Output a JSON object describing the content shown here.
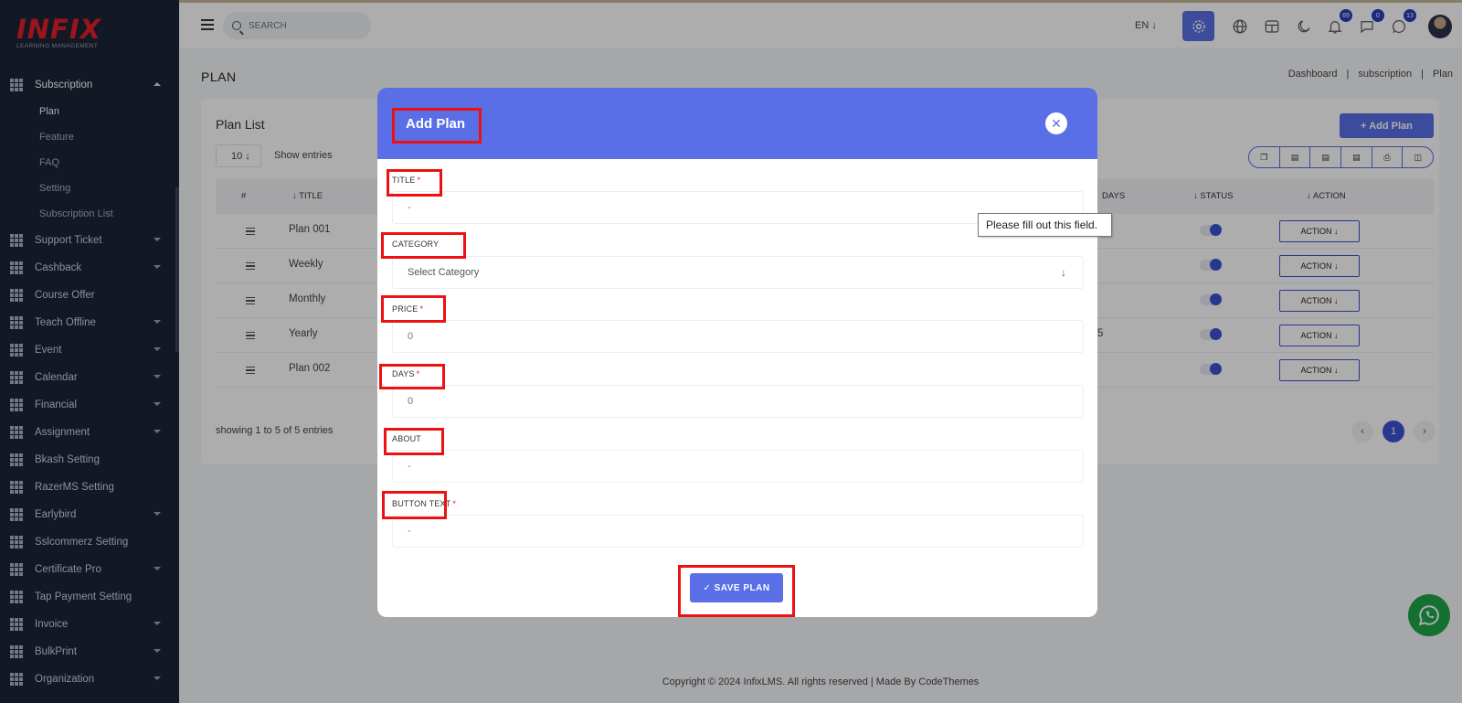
{
  "logo": {
    "main": "INFIX",
    "sub": "LEARNING MANAGEMENT"
  },
  "sidebar": {
    "open_section": "Subscription",
    "sub_items": [
      "Plan",
      "Feature",
      "FAQ",
      "Setting",
      "Subscription List"
    ],
    "active_sub": "Plan",
    "items": [
      {
        "label": "Support Ticket",
        "caret": true
      },
      {
        "label": "Cashback",
        "caret": true
      },
      {
        "label": "Course Offer",
        "caret": false
      },
      {
        "label": "Teach Offline",
        "caret": true
      },
      {
        "label": "Event",
        "caret": true
      },
      {
        "label": "Calendar",
        "caret": true
      },
      {
        "label": "Financial",
        "caret": true
      },
      {
        "label": "Assignment",
        "caret": true
      },
      {
        "label": "Bkash Setting",
        "caret": false
      },
      {
        "label": "RazerMS Setting",
        "caret": false
      },
      {
        "label": "Earlybird",
        "caret": true
      },
      {
        "label": "Sslcommerz Setting",
        "caret": false
      },
      {
        "label": "Certificate Pro",
        "caret": true
      },
      {
        "label": "Tap Payment Setting",
        "caret": false
      },
      {
        "label": "Invoice",
        "caret": true
      },
      {
        "label": "BulkPrint",
        "caret": true
      },
      {
        "label": "Organization",
        "caret": true
      }
    ]
  },
  "topbar": {
    "search_placeholder": "SEARCH",
    "lang": "EN ↓",
    "badges": {
      "notifications": "69",
      "messages": "0",
      "whatsapp": "13"
    }
  },
  "page": {
    "title": "PLAN",
    "breadcrumb": [
      "Dashboard",
      "subscription",
      "Plan"
    ]
  },
  "plan_list": {
    "title": "Plan List",
    "add_button": "+ Add Plan",
    "entries_value": "10 ↓",
    "entries_label": "Show entries",
    "columns": {
      "num": "#",
      "title": "↓ TITLE",
      "days": "DAYS",
      "status": "↓ STATUS",
      "action": "↓ ACTION"
    },
    "rows": [
      {
        "title": "Plan 001",
        "days": ""
      },
      {
        "title": "Weekly",
        "days": ""
      },
      {
        "title": "Monthly",
        "days": ""
      },
      {
        "title": "Yearly",
        "days": "5"
      },
      {
        "title": "Plan 002",
        "days": ""
      }
    ],
    "action_label": "ACTION ↓",
    "showing": "showing 1 to 5 of 5 entries",
    "current_page": "1",
    "prev": "‹",
    "next": "›"
  },
  "footer": "Copyright © 2024 InfixLMS. All rights reserved | Made By CodeThemes",
  "modal": {
    "title": "Add Plan",
    "close": "✕",
    "fields": {
      "title": {
        "label": "TITLE",
        "value": "-"
      },
      "category": {
        "label": "CATEGORY",
        "value": "Select Category"
      },
      "price": {
        "label": "PRICE",
        "value": "0"
      },
      "days": {
        "label": "DAYS",
        "value": "0"
      },
      "about": {
        "label": "ABOUT",
        "value": "-"
      },
      "button_text": {
        "label": "BUTTON TEXT",
        "value": "-"
      }
    },
    "required_mark": "*",
    "save_button": "✓ SAVE PLAN"
  },
  "tooltip": "Please fill out this field.",
  "colors": {
    "accent": "#5a6fe6",
    "sidebar": "#1c2437",
    "annotation": "#ee1111",
    "whatsapp": "#1ea749"
  }
}
